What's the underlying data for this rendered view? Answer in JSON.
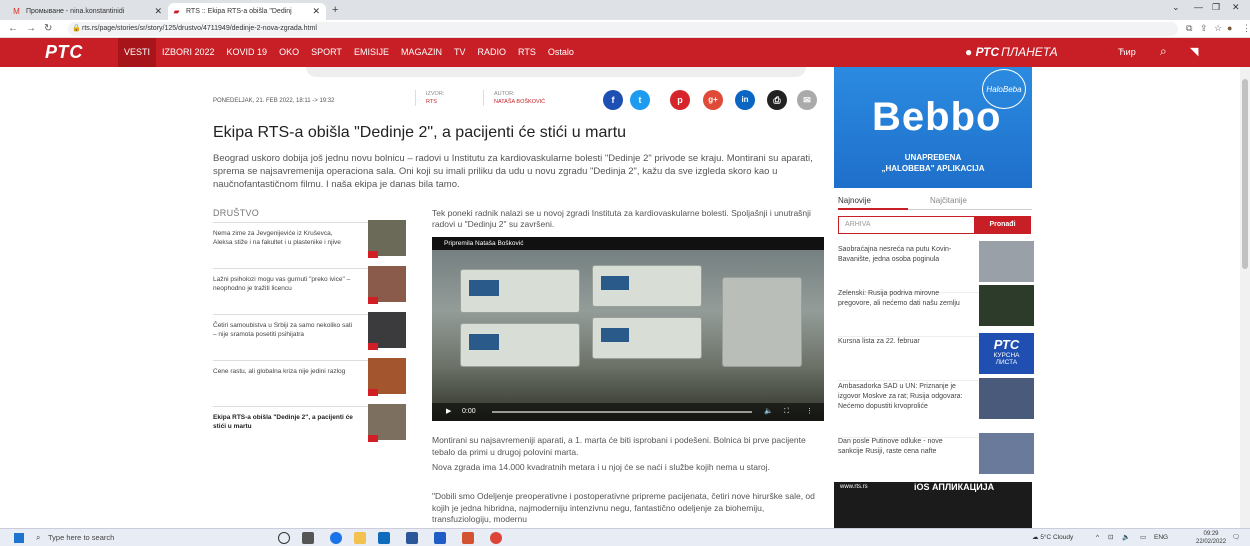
{
  "browser": {
    "tab1": {
      "title": "Промыване - nina.konstantinidi",
      "icon": "gmail-icon"
    },
    "tab2": {
      "title": "RTS :: Ekipa RTS-a obišla \"Dedinj",
      "icon": "rts-favicon"
    },
    "url": "rts.rs/page/stories/sr/story/125/drustvo/4711949/dedinje-2-nova-zgrada.html"
  },
  "site": {
    "logo": "РТС",
    "menu": [
      "VESTI",
      "IZBORI 2022",
      "KOVID 19",
      "OKO",
      "SPORT",
      "EMISIJE",
      "MAGAZIN",
      "TV",
      "RADIO",
      "RTS",
      "Ostalo"
    ],
    "active_menu": "VESTI",
    "planeta_logo": "РТС",
    "planeta_word": "ПЛАНЕТА",
    "script_toggle": "Ћир",
    "brand_color": "#c81f26"
  },
  "article": {
    "date": "PONEDELJAK, 21. FEB 2022, 18:11 -> 19:32",
    "source_label": "IZVOR:",
    "source_value": "RTS",
    "author_label": "AUTOR:",
    "author_value": "NATAŠA BOŠKOVIĆ",
    "title": "Ekipa RTS-a obišla \"Dedinje 2\", a pacijenti će stići u martu",
    "lead": "Beograd uskoro dobija još jednu novu bolnicu – radovi u Institutu za kardiovaskularne bolesti \"Dedinje 2\" privode se kraju. Montirani su aparati, sprema se najsavremenija operaciona sala. Oni koji su imali priliku da udu u novu zgradu \"Dedinja 2\", kažu da sve izgleda skoro kao u naučnofantastičnom filmu. I naša ekipa je danas bila tamo.",
    "p1": "Tek poneki radnik nalazi se u novoj zgradi Instituta za kardiovaskularne bolesti. Spoljašnji i unutrašnji radovi u \"Dedinju 2\" su završeni.",
    "video_caption": "Pripremila Nataša Bošković",
    "video_time": "0:00",
    "p2": "Montirani su najsavremeniji aparati, a 1. marta će biti isprobani i podešeni. Bolnica bi prve pacijente tebalo da primi u drugoj polovini marta.",
    "p3": "Nova zgrada ima 14.000 kvadratnih metara i u njoj će se naći i službe kojih nema u staroj.",
    "p4": "\"Dobili smo Odeljenje preoperativne i postoperativne pripreme pacijenata, četiri nove hirurške sale, od kojih je jedna hibridna, najmoderniju intenzivnu negu, fantastično odeljenje za biohemiju, transfuziologiju, modernu"
  },
  "related": {
    "section": "DRUŠTVO",
    "items": [
      {
        "text": "Nema zime za Jevgenijeviće iz Kruševca, Aleksa stiže i na fakultet i u plastenike i njive",
        "bold": false,
        "color": "#6b6a58"
      },
      {
        "text": "Lažni psiholozi mogu vas gurnuti \"preko ivice\" – neophodno je tražiti licencu",
        "bold": false,
        "color": "#8a5a4a"
      },
      {
        "text": "Četiri samoubistva u Srbiji za samo nekoliko sati – nije sramota posetiti psihijatra",
        "bold": false,
        "color": "#3b3a3c"
      },
      {
        "text": "Cene rastu, ali globalna kriza nije jedini razlog",
        "bold": false,
        "color": "#a3552e"
      },
      {
        "text": "Ekipa RTS-a obišla \"Dedinje 2\", a pacijenti će stići u martu",
        "bold": true,
        "color": "#7c6f5f"
      }
    ]
  },
  "sidebar": {
    "ad_brand": "Bebbo",
    "ad_badge": "HaloBeba",
    "ad_line1": "UNAPREĐENA",
    "ad_line2": "„HALOBEBA\" APLIKACIJA",
    "tab_latest": "Najnovije",
    "tab_read": "Najčitanije",
    "archive_placeholder": "ARHIVA",
    "search_button": "Pronađi",
    "news": [
      {
        "text": "Saobraćajna nesreća na putu Kovin-Bavanište, jedna osoba poginula",
        "color": "#9aa0a8"
      },
      {
        "text": "Zelenski: Rusija podriva mirovne pregovore, ali nećemo dati našu zemlju",
        "color": "#2c3b2a"
      },
      {
        "text": "Kursna lista za 22. februar",
        "color": "#1f4fb0",
        "img_text1": "РТС",
        "img_text2": "КУРСНА ЛИСТА"
      },
      {
        "text": "Ambasadorka SAD u UN: Priznanje je izgovor Moskve za rat; Rusija odgovara: Nećemo dopustiti krvoproliće",
        "color": "#4a5a7a"
      },
      {
        "text": "Dan posle Putinove odluke - nove sankcije Rusiji, raste cena nafte",
        "color": "#6a7a9a"
      }
    ],
    "ios_left": "www.rts.rs",
    "ios_right": "iOS АПЛИКАЦИЈА"
  },
  "taskbar": {
    "search_placeholder": "Type here to search",
    "weather": "5°C Cloudy",
    "lang": "ENG",
    "time": "09:29",
    "date": "22/02/2022"
  }
}
